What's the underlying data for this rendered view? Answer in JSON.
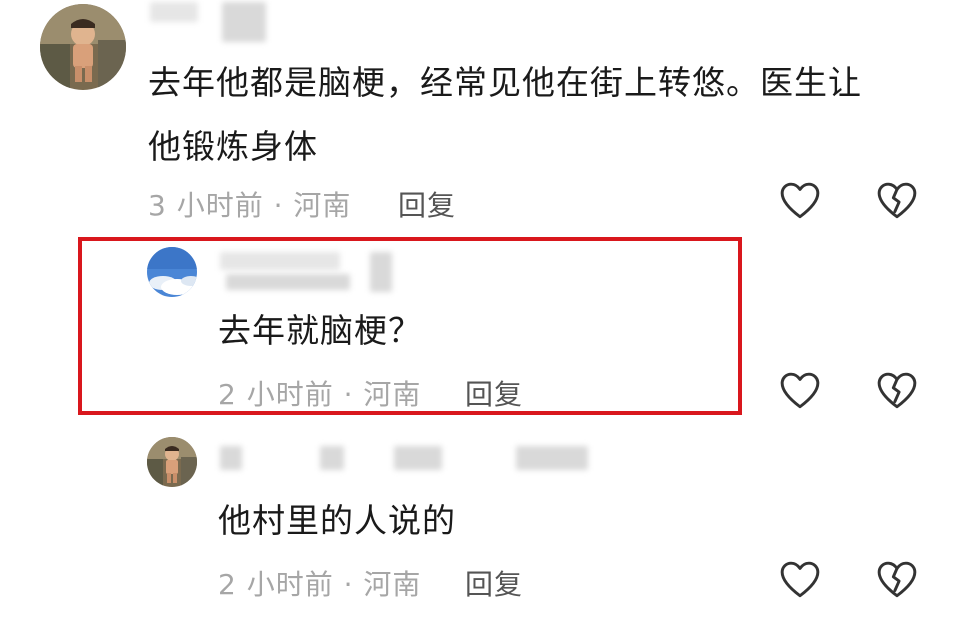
{
  "comments": [
    {
      "text_line1": "去年他都是脑梗，经常见他在街上转悠。医生让",
      "text_line2": "他锻炼身体",
      "meta": "3 小时前 · 河南",
      "reply_label": "回复",
      "avatar": "child-photo"
    },
    {
      "text": "去年就脑梗？",
      "meta": "2 小时前 · 河南",
      "reply_label": "回复",
      "avatar": "sky-photo",
      "highlighted": true,
      "highlight_color": "#d9171d"
    },
    {
      "text": "他村里的人说的",
      "meta": "2 小时前 · 河南",
      "reply_label": "回复",
      "avatar": "child-photo"
    }
  ],
  "icons": {
    "like": "heart-outline-icon",
    "dislike": "broken-heart-icon"
  }
}
